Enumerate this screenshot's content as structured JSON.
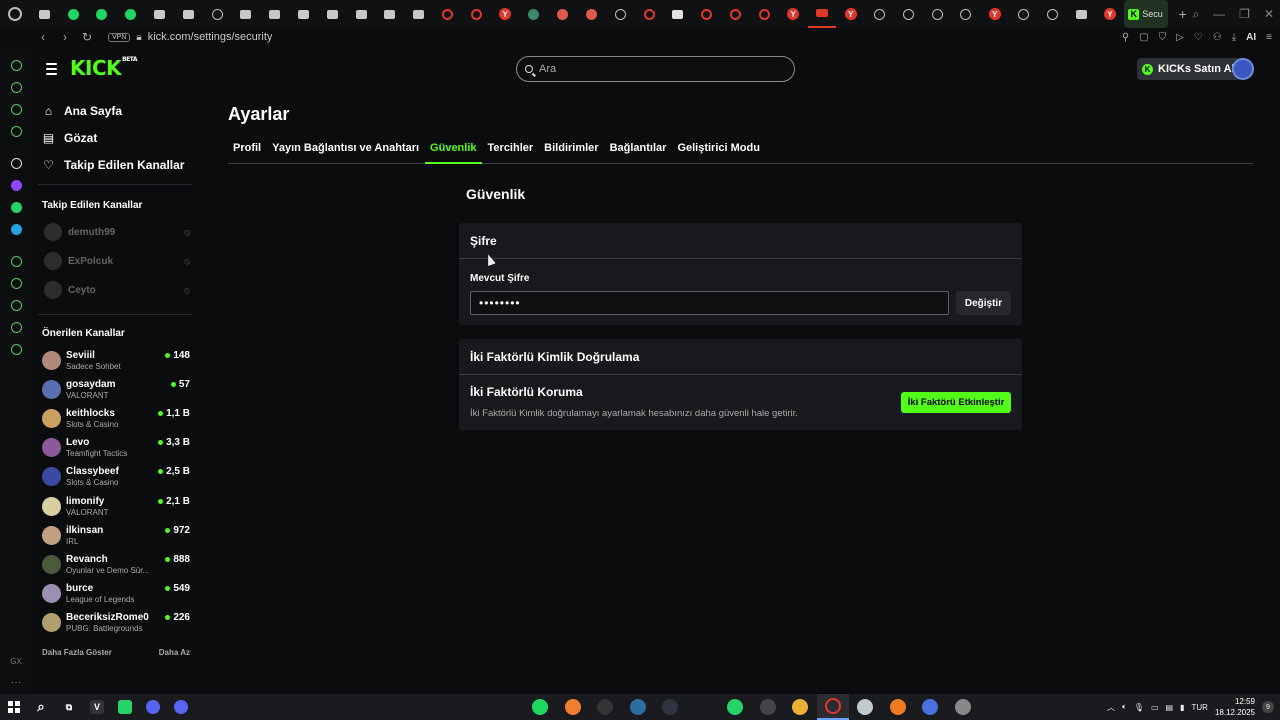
{
  "browser": {
    "active_tab_label": "Secu",
    "url": "kick.com/settings/security",
    "vpn_label": "VPN",
    "ai_label": "AI",
    "tabs": [
      {
        "kind": "sq",
        "color": "#c8c8c8"
      },
      {
        "kind": "dot",
        "color": "#1ed760"
      },
      {
        "kind": "dot",
        "color": "#1ed760"
      },
      {
        "kind": "dot",
        "color": "#1ed760"
      },
      {
        "kind": "sq",
        "color": "#c8c8c8"
      },
      {
        "kind": "sq",
        "color": "#c8c8c8"
      },
      {
        "kind": "ringw",
        "color": "#bbbbbb"
      },
      {
        "kind": "sq",
        "color": "#c8c8c8"
      },
      {
        "kind": "sq",
        "color": "#c8c8c8"
      },
      {
        "kind": "sq",
        "color": "#c8c8c8"
      },
      {
        "kind": "sq",
        "color": "#c8c8c8"
      },
      {
        "kind": "sq",
        "color": "#c8c8c8"
      },
      {
        "kind": "sq",
        "color": "#c8c8c8"
      },
      {
        "kind": "sq",
        "color": "#c8c8c8"
      },
      {
        "kind": "ring",
        "color": "#e0392b"
      },
      {
        "kind": "ring",
        "color": "#e0392b"
      },
      {
        "kind": "y",
        "color": "#e0392b"
      },
      {
        "kind": "dot",
        "color": "#3a8a6a"
      },
      {
        "kind": "dot",
        "color": "#e05a4a"
      },
      {
        "kind": "dot",
        "color": "#e05a4a"
      },
      {
        "kind": "ringw",
        "color": "#bbbbbb"
      },
      {
        "kind": "ring",
        "color": "#e0392b"
      },
      {
        "kind": "sq",
        "color": "#e0e0e0"
      },
      {
        "kind": "ring",
        "color": "#e0392b"
      },
      {
        "kind": "ring",
        "color": "#e0392b"
      },
      {
        "kind": "ring",
        "color": "#e0392b"
      },
      {
        "kind": "y",
        "color": "#e0392b"
      },
      {
        "kind": "yt",
        "color": "#e0392b"
      },
      {
        "kind": "y",
        "color": "#e0392b"
      },
      {
        "kind": "ringw",
        "color": "#bbbbbb"
      },
      {
        "kind": "ringw",
        "color": "#bbbbbb"
      },
      {
        "kind": "ringw",
        "color": "#bbbbbb"
      },
      {
        "kind": "ringw",
        "color": "#bbbbbb"
      },
      {
        "kind": "y",
        "color": "#e0392b"
      },
      {
        "kind": "ringw",
        "color": "#bbbbbb"
      },
      {
        "kind": "ringw",
        "color": "#bbbbbb"
      },
      {
        "kind": "sq",
        "color": "#c8c8c8"
      },
      {
        "kind": "y",
        "color": "#e0392b"
      }
    ]
  },
  "header": {
    "logo": "KICK",
    "logo_badge": "BETA",
    "search_placeholder": "Ara",
    "buy_button": "KICKs Satın Al",
    "accent": "#53fc18"
  },
  "sidebar": {
    "nav": [
      {
        "label": "Ana Sayfa",
        "icon": "home-icon"
      },
      {
        "label": "Gözat",
        "icon": "browse-icon"
      },
      {
        "label": "Takip Edilen Kanallar",
        "icon": "heart-icon"
      }
    ],
    "followed_heading": "Takip Edilen Kanallar",
    "followed": [
      {
        "name": "demuth99"
      },
      {
        "name": "ExPolcuk"
      },
      {
        "name": "Ceyto"
      }
    ],
    "recommended_heading": "Önerilen Kanallar",
    "recommended": [
      {
        "name": "Seviiil",
        "category": "Sadece Sohbet",
        "viewers": "148",
        "color": "#b08a7a"
      },
      {
        "name": "gosaydam",
        "category": "VALORANT",
        "viewers": "57",
        "color": "#5a6fb0"
      },
      {
        "name": "keithlocks",
        "category": "Slots & Casino",
        "viewers": "1,1 B",
        "color": "#c9a060"
      },
      {
        "name": "Levo",
        "category": "Teamfight Tactics",
        "viewers": "3,3 B",
        "color": "#8a5a9a"
      },
      {
        "name": "Classybeef",
        "category": "Slots & Casino",
        "viewers": "2,5 B",
        "color": "#3a4aa0"
      },
      {
        "name": "limonify",
        "category": "VALORANT",
        "viewers": "2,1 B",
        "color": "#d8d0a0"
      },
      {
        "name": "ilkinsan",
        "category": "IRL",
        "viewers": "972",
        "color": "#c0a080"
      },
      {
        "name": "Revanch",
        "category": "Oyunlar ve Demo Sür...",
        "viewers": "888",
        "color": "#4a5a3a"
      },
      {
        "name": "burce",
        "category": "League of Legends",
        "viewers": "549",
        "color": "#9a90b0"
      },
      {
        "name": "BeceriksizRome0",
        "category": "PUBG: Battlegrounds",
        "viewers": "226",
        "color": "#b0a070"
      }
    ],
    "show_more": "Daha Fazla Göster",
    "show_less": "Daha Az"
  },
  "main": {
    "title": "Ayarlar",
    "tabs": [
      {
        "label": "Profil",
        "active": false
      },
      {
        "label": "Yayın Bağlantısı ve Anahtarı",
        "active": false
      },
      {
        "label": "Güvenlik",
        "active": true
      },
      {
        "label": "Tercihler",
        "active": false
      },
      {
        "label": "Bildirimler",
        "active": false
      },
      {
        "label": "Bağlantılar",
        "active": false
      },
      {
        "label": "Geliştirici Modu",
        "active": false
      }
    ],
    "section_title": "Güvenlik",
    "password_card": {
      "title": "Şifre",
      "field_label": "Mevcut Şifre",
      "value": "••••••••",
      "change_button": "Değiştir"
    },
    "tfa_card": {
      "title": "İki Faktörlü Kimlik Doğrulama",
      "subtitle": "İki Faktörlü Koruma",
      "description": "İki Faktörlü Kimlik doğrulamayı ayarlamak hesabınızı daha güvenli hale getirir.",
      "button": "İki Faktörü Etkinleştir"
    }
  },
  "taskbar": {
    "language": "TUR",
    "time": "12:59",
    "date": "18.12.2025",
    "notifications": "9",
    "apps": [
      {
        "name": "spotify-icon",
        "color": "#1ed760"
      },
      {
        "name": "audacity-icon",
        "color": "#f08030"
      },
      {
        "name": "epic-icon",
        "color": "#333333"
      },
      {
        "name": "steam-icon",
        "color": "#2a6fa0"
      },
      {
        "name": "terminal-icon",
        "color": "#2e3440"
      },
      {
        "name": "vim-icon",
        "color": "#1a1a1a"
      },
      {
        "name": "whatsapp-icon",
        "color": "#25d366"
      },
      {
        "name": "obs-icon",
        "color": "#444444"
      },
      {
        "name": "chrome-icon",
        "color": "#e8b030"
      },
      {
        "name": "opera-gx-icon",
        "color": "#e0392b"
      },
      {
        "name": "files-icon",
        "color": "#c0c8d0"
      },
      {
        "name": "app-orange-icon",
        "color": "#f07a20"
      },
      {
        "name": "app-blue-icon",
        "color": "#4a70e0"
      },
      {
        "name": "app-mono-icon",
        "color": "#888888"
      }
    ]
  }
}
